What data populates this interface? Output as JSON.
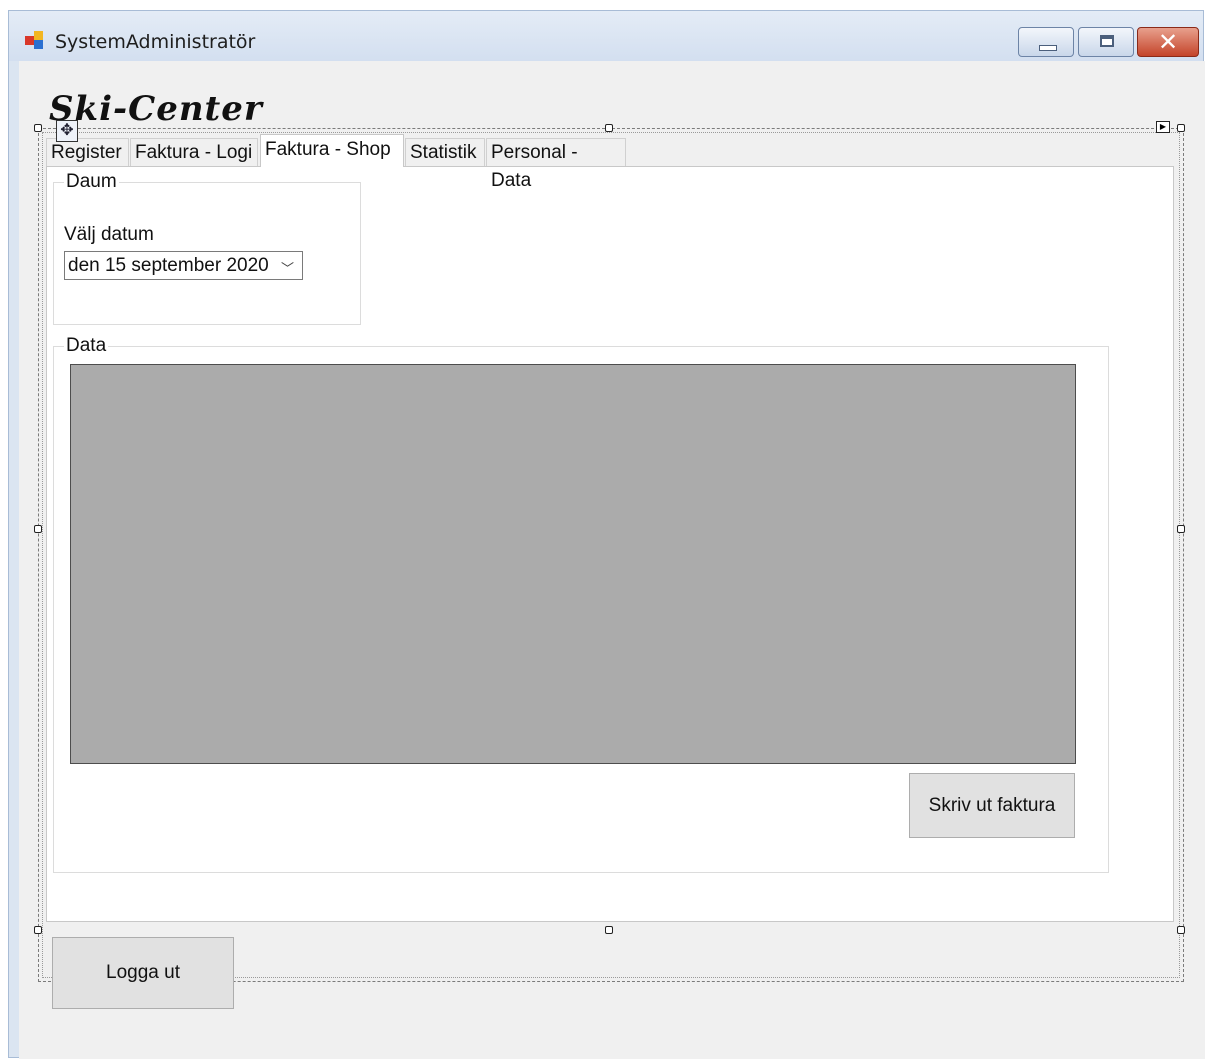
{
  "window": {
    "title": "SystemAdministratör",
    "close_glyph": "✕"
  },
  "logo": {
    "text": "Ski-Center"
  },
  "tabs": [
    {
      "label": "Register",
      "active": false
    },
    {
      "label": "Faktura - Logi",
      "active": false
    },
    {
      "label": "Faktura - Shop",
      "active": true
    },
    {
      "label": "Statistik",
      "active": false
    },
    {
      "label": "Personal - Data",
      "active": false
    }
  ],
  "date_group": {
    "title": "Daum",
    "label": "Välj datum",
    "selected_date": "den 15 september 2020"
  },
  "data_group": {
    "title": "Data",
    "print_button": "Skriv ut faktura"
  },
  "logout_button": "Logga ut",
  "icons": {
    "app": "app-window-icon",
    "move": "move-icon",
    "smart_tag": "smart-tag-arrow-icon",
    "dropdown": "chevron-down-icon"
  },
  "colors": {
    "grid_bg": "#ababab",
    "client_bg": "#f0f0f0",
    "close_button": "#c4442a"
  }
}
